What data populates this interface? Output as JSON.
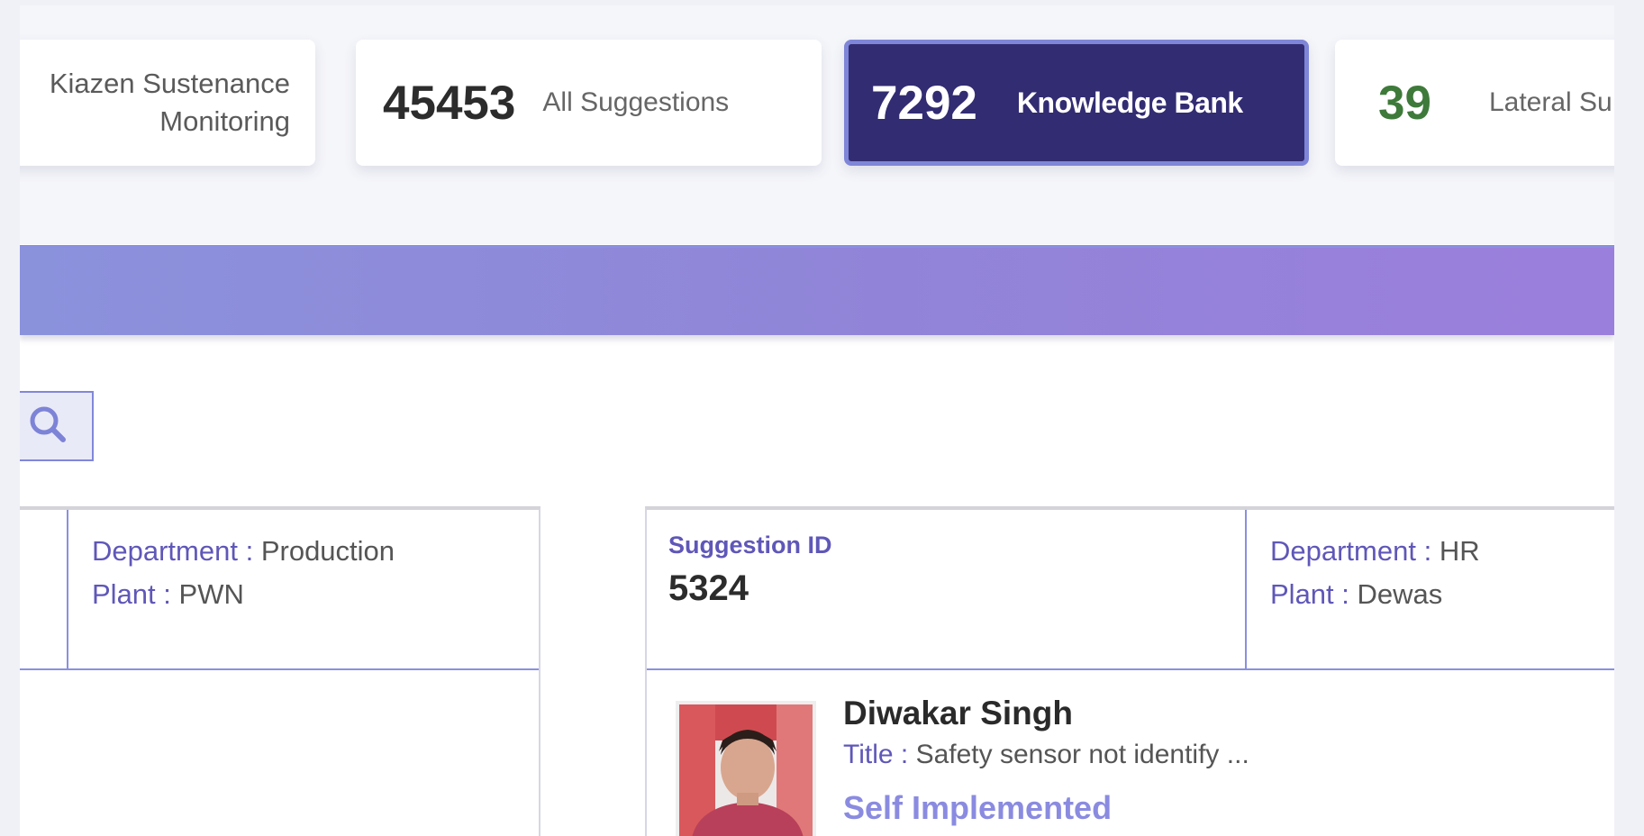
{
  "stats": {
    "kiazen": {
      "line1": "Kiazen Sustenance",
      "line2": "Monitoring"
    },
    "all": {
      "count": "45453",
      "label": "All Suggestions"
    },
    "knowledge": {
      "count": "7292",
      "label": "Knowledge Bank"
    },
    "lateral": {
      "count": "39",
      "label": "Lateral Su"
    }
  },
  "colors": {
    "active_card": "#322c72",
    "active_card_border": "#7f86d8",
    "accent": "#5f57b8",
    "lateral_count": "#3e7a3a",
    "status": "#8a8be0"
  },
  "search": {
    "icon": "search-icon"
  },
  "cards": [
    {
      "department_key": "Department :",
      "department": "Production",
      "plant_key": "Plant :",
      "plant": "PWN"
    },
    {
      "suggestion_id_label": "Suggestion ID",
      "suggestion_id": "5324",
      "department_key": "Department :",
      "department": "HR",
      "plant_key": "Plant :",
      "plant": "Dewas",
      "user_name": "Diwakar Singh",
      "title_key": "Title :",
      "title": "Safety sensor not identify ...",
      "status": "Self Implemented"
    }
  ]
}
